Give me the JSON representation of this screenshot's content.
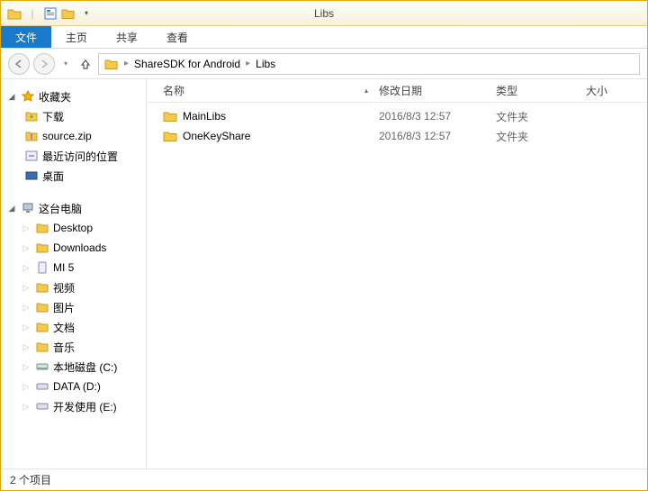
{
  "window": {
    "title": "Libs"
  },
  "ribbon": {
    "file": "文件",
    "home": "主页",
    "share": "共享",
    "view": "查看"
  },
  "breadcrumb": {
    "items": [
      "ShareSDK for Android",
      "Libs"
    ]
  },
  "columns": {
    "name": "名称",
    "date": "修改日期",
    "type": "类型",
    "size": "大小"
  },
  "rows": [
    {
      "name": "MainLibs",
      "date": "2016/8/3 12:57",
      "type": "文件夹"
    },
    {
      "name": "OneKeyShare",
      "date": "2016/8/3 12:57",
      "type": "文件夹"
    }
  ],
  "sidebar": {
    "favorites": {
      "label": "收藏夹",
      "items": [
        "下载",
        "source.zip",
        "最近访问的位置",
        "桌面"
      ]
    },
    "thispc": {
      "label": "这台电脑",
      "items": [
        "Desktop",
        "Downloads",
        "MI 5",
        "视频",
        "图片",
        "文档",
        "音乐",
        "本地磁盘 (C:)",
        "DATA (D:)",
        "开发使用 (E:)"
      ]
    }
  },
  "status": {
    "text": "2 个项目"
  }
}
